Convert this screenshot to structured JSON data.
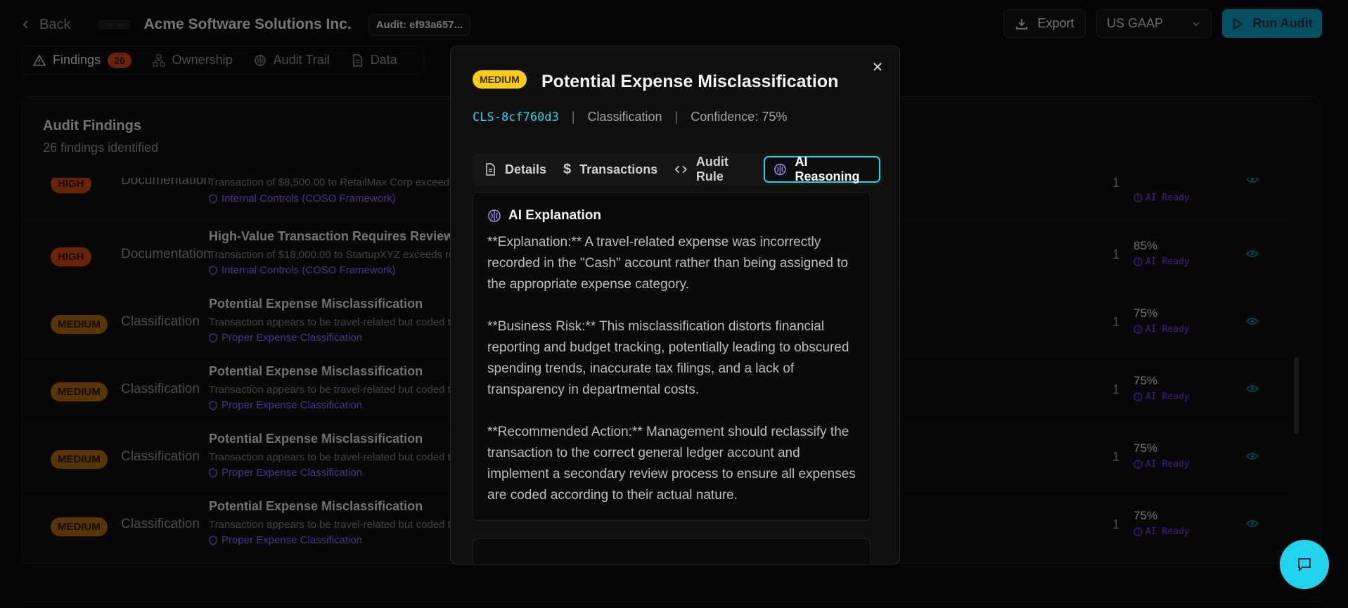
{
  "topbar": {
    "back_label": "Back",
    "logo_text": "Logo Here",
    "company": "Acme Software Solutions Inc.",
    "audit_id": "Audit: ef93a657...",
    "export_label": "Export",
    "standard": "US GAAP",
    "run_label": "Run Audit"
  },
  "tabs": {
    "findings": "Findings",
    "findings_count": "26",
    "ownership": "Ownership",
    "audit_trail": "Audit Trail",
    "data": "Data"
  },
  "findings": {
    "title": "Audit Findings",
    "subtitle": "26 findings identified",
    "rows": [
      {
        "severity": "HIGH",
        "category": "Documentation",
        "title": "",
        "desc": "Transaction of $8,500.00 to RetailMax Corp exceeds",
        "rule": "Internal Controls (COSO Framework)",
        "count": "1",
        "conf": "",
        "ai": "AI Ready"
      },
      {
        "severity": "HIGH",
        "category": "Documentation",
        "title": "High-Value Transaction Requires Review",
        "desc": "Transaction of $18,000.00 to StartupXYZ exceeds rev",
        "rule": "Internal Controls (COSO Framework)",
        "count": "1",
        "conf": "85%",
        "ai": "AI Ready"
      },
      {
        "severity": "MEDIUM",
        "category": "Classification",
        "title": "Potential Expense Misclassification",
        "desc": "Transaction appears to be travel-related but coded t",
        "rule": "Proper Expense Classification",
        "count": "1",
        "conf": "75%",
        "ai": "AI Ready"
      },
      {
        "severity": "MEDIUM",
        "category": "Classification",
        "title": "Potential Expense Misclassification",
        "desc": "Transaction appears to be travel-related but coded t",
        "rule": "Proper Expense Classification",
        "count": "1",
        "conf": "75%",
        "ai": "AI Ready"
      },
      {
        "severity": "MEDIUM",
        "category": "Classification",
        "title": "Potential Expense Misclassification",
        "desc": "Transaction appears to be travel-related but coded t",
        "rule": "Proper Expense Classification",
        "count": "1",
        "conf": "75%",
        "ai": "AI Ready"
      },
      {
        "severity": "MEDIUM",
        "category": "Classification",
        "title": "Potential Expense Misclassification",
        "desc": "Transaction appears to be travel-related but coded t",
        "rule": "Proper Expense Classification",
        "count": "1",
        "conf": "75%",
        "ai": "AI Ready"
      }
    ]
  },
  "modal": {
    "severity": "MEDIUM",
    "title": "Potential Expense Misclassification",
    "id": "CLS-8cf760d3",
    "sep": "|",
    "category": "Classification",
    "confidence": "Confidence: 75%",
    "tabs": [
      "Details",
      "Transactions",
      "Audit Rule",
      "AI Reasoning"
    ],
    "panel_title": "AI Explanation",
    "paragraphs": [
      "**Explanation:** A travel-related expense was incorrectly recorded in the \"Cash\" account rather than being assigned to the appropriate expense category.",
      "**Business Risk:** This misclassification distorts financial reporting and budget tracking, potentially leading to obscured spending trends, inaccurate tax filings, and a lack of transparency in departmental costs.",
      "**Recommended Action:** Management should reclassify the transaction to the correct general ledger account and implement a secondary review process to ensure all expenses are coded according to their actual nature."
    ]
  },
  "colors": {
    "accent": "#22d3ee",
    "high": "#c2410c",
    "medium": "#a16207",
    "medium_modal": "#facc15",
    "ai": "#8b5cf6"
  }
}
